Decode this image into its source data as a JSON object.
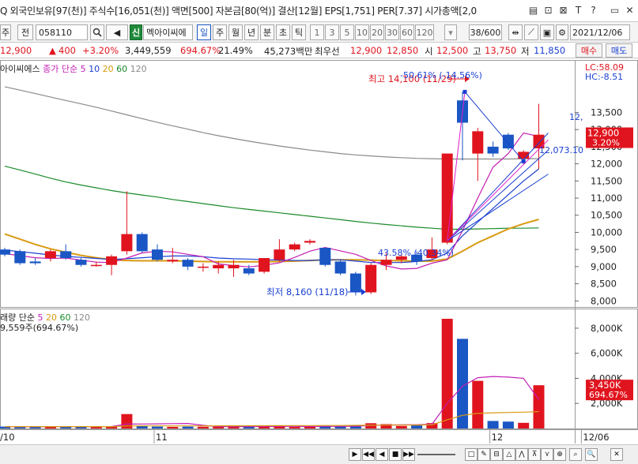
{
  "infobar": {
    "text": "Q 외국인보유[97(천)] 주식수[16,051(천)] 액면[500] 자본금[80(억)] 결산[12월] EPS[1,751] PER[7.37] 시가총액[2,0",
    "icons": [
      "copy-icon",
      "export-icon",
      "close-box-icon",
      "text-icon",
      "help-icon",
      "window-icon",
      "close-icon"
    ],
    "icon_glyphs": [
      "▤",
      "⊡",
      "⊠",
      "T",
      "?",
      "▭",
      "✕"
    ]
  },
  "toolbar": {
    "market": "주",
    "prefix": "전",
    "code": "058110",
    "search_glyph": "🔍",
    "sound_glyph": "◀",
    "badge": "신",
    "name": "멕아이씨에",
    "periods": [
      "일",
      "주",
      "월",
      "년",
      "분",
      "초",
      "틱"
    ],
    "active_period": "일",
    "intervals": [
      "1",
      "3",
      "5",
      "10",
      "20",
      "30",
      "60",
      "120"
    ],
    "count": "38/600",
    "date": "2021/12/06"
  },
  "quote": {
    "price": "12,900",
    "change": "400",
    "rate": "+3.20%",
    "volume": "3,449,559",
    "vol_ratio": "694.67%",
    "turnover": "21.49%",
    "amount": "45,273백만",
    "best_label": "최우선",
    "best_ask": "12,900",
    "best_bid": "12,850",
    "open_label": "시",
    "open": "12,500",
    "high_label": "고",
    "high": "13,750",
    "low_label": "저",
    "low": "11,850",
    "buy_label": "매수",
    "sell_label": "매도"
  },
  "legend": {
    "name": "아이씨에스",
    "close_label": "종가 단순",
    "ma": [
      "5",
      "10",
      "20",
      "60",
      "120"
    ],
    "ma_colors": [
      "#c41fb5",
      "#1a3fd1",
      "#d89a12",
      "#1a8a2a",
      "#8a8a8a"
    ],
    "lc": "LC:58.09",
    "hc": "HC:-8.51"
  },
  "vol_legend": {
    "label": "래량 단순",
    "ma": [
      "5",
      "20",
      "60",
      "120"
    ],
    "ma_colors": [
      "#c41fb5",
      "#d89a12",
      "#1a8a2a",
      "#8a8a8a"
    ],
    "line2": "9,559주(694.67%)"
  },
  "chart_data": {
    "type": "candlestick",
    "price_axis": {
      "ticks": [
        "13,500",
        "13,000",
        "12,500",
        "12,000",
        "11,500",
        "11,000",
        "10,500",
        "10,000",
        "9,500",
        "9,000",
        "8,500",
        "8,000"
      ],
      "tick_values": [
        13500,
        13000,
        12500,
        12000,
        11500,
        11000,
        10500,
        10000,
        9500,
        9000,
        8500,
        8000
      ],
      "ylim": [
        7800,
        14800
      ],
      "current_label": "12,900",
      "current_rate": "3.20%",
      "current": 12900
    },
    "volume_axis": {
      "ticks": [
        "8,000K",
        "6,000K",
        "4,000K",
        "2,000K"
      ],
      "tick_values": [
        8000,
        6000,
        4000,
        2000
      ],
      "ylim": [
        0,
        9000
      ],
      "current_label": "3,450K",
      "current_rate": "694.67%",
      "current": 3450
    },
    "date_labels": [
      {
        "i": 0,
        "label": "/10"
      },
      {
        "i": 10,
        "label": "11"
      },
      {
        "i": 32,
        "label": "12"
      },
      {
        "i": 38,
        "label": "12/06"
      }
    ],
    "annotations": {
      "high": "최고 14,100 (11/29)",
      "low": "최저 8,160 (11/18)",
      "fib_top": "-50.61% (-14.56%)",
      "fib_mid": "12,073.10",
      "fib_low": "43.58% (40.34%)",
      "fan_end": "12,"
    },
    "candles": [
      {
        "o": 9500,
        "c": 9350,
        "h": 9550,
        "l": 9300
      },
      {
        "o": 9450,
        "c": 9100,
        "h": 9500,
        "l": 9050
      },
      {
        "o": 9150,
        "c": 9100,
        "h": 9250,
        "l": 9050
      },
      {
        "o": 9250,
        "c": 9450,
        "h": 9500,
        "l": 9150
      },
      {
        "o": 9450,
        "c": 9250,
        "h": 9650,
        "l": 9200
      },
      {
        "o": 9200,
        "c": 9050,
        "h": 9250,
        "l": 9000
      },
      {
        "o": 9050,
        "c": 9050,
        "h": 9150,
        "l": 9000
      },
      {
        "o": 9050,
        "c": 9300,
        "h": 9350,
        "l": 8750
      },
      {
        "o": 9450,
        "c": 9950,
        "h": 11200,
        "l": 9350
      },
      {
        "o": 9950,
        "c": 9450,
        "h": 10000,
        "l": 9400
      },
      {
        "o": 9500,
        "c": 9200,
        "h": 9650,
        "l": 9150
      },
      {
        "o": 9150,
        "c": 9200,
        "h": 9550,
        "l": 9100
      },
      {
        "o": 9200,
        "c": 9000,
        "h": 9250,
        "l": 8900
      },
      {
        "o": 9000,
        "c": 9000,
        "h": 9100,
        "l": 8850
      },
      {
        "o": 8950,
        "c": 9050,
        "h": 9150,
        "l": 8800
      },
      {
        "o": 8950,
        "c": 9050,
        "h": 9200,
        "l": 8700
      },
      {
        "o": 8950,
        "c": 8800,
        "h": 9050,
        "l": 8750
      },
      {
        "o": 8850,
        "c": 9250,
        "h": 9250,
        "l": 8800
      },
      {
        "o": 9200,
        "c": 9500,
        "h": 9800,
        "l": 9150
      },
      {
        "o": 9500,
        "c": 9650,
        "h": 9700,
        "l": 9450
      },
      {
        "o": 9700,
        "c": 9750,
        "h": 9800,
        "l": 9650
      },
      {
        "o": 9550,
        "c": 9050,
        "h": 9550,
        "l": 9000
      },
      {
        "o": 9150,
        "c": 8800,
        "h": 9200,
        "l": 8750
      },
      {
        "o": 8800,
        "c": 8250,
        "h": 8850,
        "l": 8160
      },
      {
        "o": 8250,
        "c": 9050,
        "h": 9100,
        "l": 8200
      },
      {
        "o": 9050,
        "c": 9200,
        "h": 9400,
        "l": 8900
      },
      {
        "o": 9200,
        "c": 9300,
        "h": 9350,
        "l": 9100
      },
      {
        "o": 9350,
        "c": 9150,
        "h": 9450,
        "l": 9050
      },
      {
        "o": 9250,
        "c": 9500,
        "h": 9850,
        "l": 9200
      },
      {
        "o": 9700,
        "c": 12300,
        "h": 12300,
        "l": 9650
      },
      {
        "o": 13850,
        "c": 13200,
        "h": 14100,
        "l": 12100
      },
      {
        "o": 12300,
        "c": 12950,
        "h": 13050,
        "l": 11500
      },
      {
        "o": 12500,
        "c": 12300,
        "h": 12650,
        "l": 12200
      },
      {
        "o": 12850,
        "c": 12450,
        "h": 12900,
        "l": 12400
      },
      {
        "o": 12150,
        "c": 12350,
        "h": 12400,
        "l": 12000
      },
      {
        "o": 12450,
        "c": 12850,
        "h": 13750,
        "l": 11850
      }
    ],
    "volumes": [
      150,
      110,
      140,
      190,
      150,
      130,
      130,
      150,
      1150,
      200,
      150,
      130,
      150,
      140,
      140,
      140,
      160,
      200,
      200,
      120,
      130,
      200,
      180,
      280,
      420,
      350,
      200,
      250,
      430,
      8750,
      7150,
      3800,
      600,
      550,
      450,
      3450
    ],
    "ma_lines": [
      {
        "name": "5",
        "color": "#c41fb5",
        "values": [
          9380,
          9320,
          9260,
          9240,
          9250,
          9190,
          9130,
          9120,
          9250,
          9400,
          9450,
          9430,
          9360,
          9290,
          9080,
          9030,
          8990,
          9040,
          9110,
          9270,
          9450,
          9560,
          9460,
          9360,
          9180,
          9020,
          8930,
          8950,
          9100,
          9200,
          10050,
          11000,
          11900,
          12300,
          12900,
          12800
        ]
      },
      {
        "name": "10",
        "color": "#1a3fd1",
        "values": [
          9480,
          9440,
          9390,
          9340,
          9300,
          9270,
          9240,
          9210,
          9230,
          9260,
          9290,
          9310,
          9310,
          9290,
          9250,
          9230,
          9220,
          9200,
          9190,
          9180,
          9180,
          9200,
          9200,
          9160,
          9120,
          9120,
          9120,
          9150,
          9200,
          9400,
          9900,
          10300,
          10700,
          11100,
          11500,
          11850
        ]
      },
      {
        "name": "20",
        "color": "#d89a12",
        "values": [
          9950,
          9800,
          9650,
          9520,
          9420,
          9330,
          9260,
          9200,
          9180,
          9170,
          9170,
          9170,
          9160,
          9150,
          9140,
          9140,
          9140,
          9140,
          9150,
          9160,
          9180,
          9200,
          9200,
          9200,
          9190,
          9180,
          9170,
          9160,
          9160,
          9220,
          9450,
          9700,
          9900,
          10100,
          10250,
          10380
        ]
      },
      {
        "name": "60",
        "color": "#1a8a2a",
        "values": [
          11930,
          11820,
          11700,
          11580,
          11470,
          11380,
          11300,
          11220,
          11150,
          11090,
          11030,
          10960,
          10900,
          10840,
          10780,
          10720,
          10670,
          10620,
          10570,
          10520,
          10470,
          10420,
          10370,
          10320,
          10270,
          10230,
          10190,
          10150,
          10120,
          10090,
          10090,
          10100,
          10110,
          10120,
          10120,
          10130
        ]
      },
      {
        "name": "120",
        "color": "#8a8a8a",
        "values": [
          14250,
          14150,
          14050,
          13950,
          13850,
          13750,
          13650,
          13540,
          13430,
          13320,
          13210,
          13110,
          13010,
          12910,
          12820,
          12740,
          12660,
          12590,
          12520,
          12460,
          12400,
          12350,
          12300,
          12260,
          12230,
          12200,
          12180,
          12160,
          12150,
          12140,
          12140,
          12140,
          12140,
          12140,
          12150,
          12150
        ]
      }
    ],
    "vol_ma_lines": [
      {
        "name": "5",
        "color": "#c41fb5",
        "values": [
          150,
          140,
          140,
          150,
          150,
          145,
          150,
          160,
          350,
          360,
          370,
          390,
          400,
          250,
          150,
          150,
          150,
          160,
          170,
          170,
          160,
          170,
          170,
          180,
          240,
          280,
          290,
          300,
          340,
          2000,
          3380,
          4050,
          4150,
          4100,
          4000,
          2300
        ]
      },
      {
        "name": "20",
        "color": "#d89a12",
        "values": [
          150,
          150,
          150,
          150,
          150,
          150,
          150,
          150,
          200,
          210,
          210,
          210,
          210,
          210,
          215,
          215,
          220,
          220,
          225,
          230,
          230,
          240,
          240,
          250,
          260,
          270,
          270,
          280,
          290,
          700,
          1050,
          1200,
          1250,
          1280,
          1300,
          1350
        ]
      }
    ]
  },
  "status": {
    "buttons": [
      "▶",
      "◀◀",
      "◀",
      "■",
      "▶▶"
    ],
    "tools": [
      "□",
      "✎",
      "⊟",
      "△",
      "⋀",
      "⊼",
      "⋎",
      "⊕",
      "⌕",
      "🔍",
      "✕"
    ]
  }
}
